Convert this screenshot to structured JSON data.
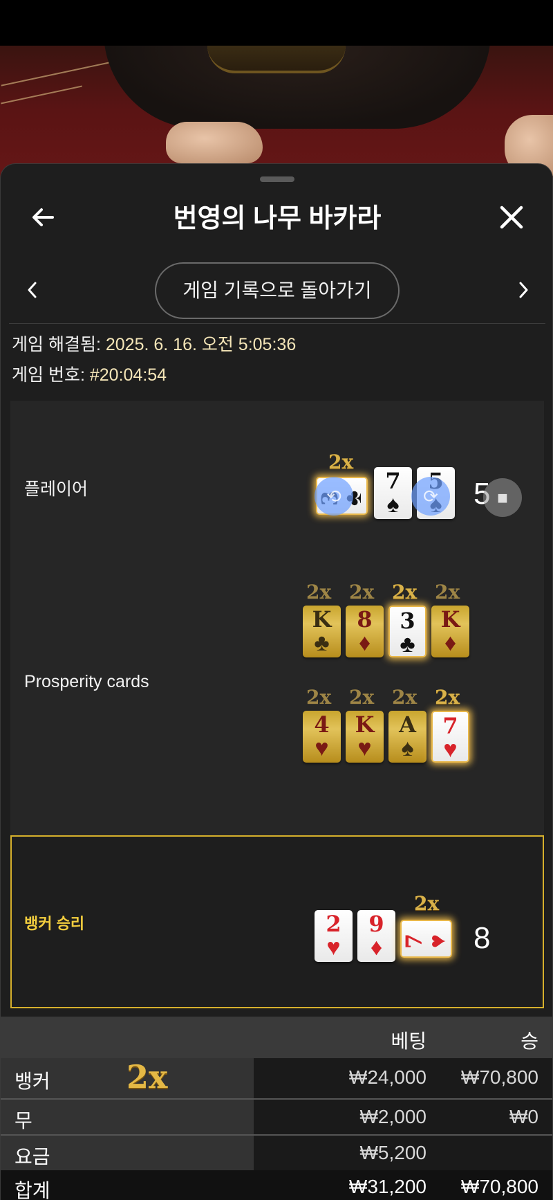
{
  "header": {
    "title": "번영의 나무 바카라"
  },
  "nav": {
    "back_to_history": "게임 기록으로 돌아가기"
  },
  "meta": {
    "resolved_label": "게임 해결됨:",
    "resolved_value": "2025. 6. 16. 오전 5:05:36",
    "round_label": "게임 번호:",
    "round_value": "#20:04:54"
  },
  "player": {
    "label": "플레이어",
    "multiplier": "2x",
    "score": "5",
    "cards": [
      {
        "rank": "3",
        "suit": "♣",
        "color": "black",
        "orientation": "sideways",
        "highlight": true
      },
      {
        "rank": "7",
        "suit": "♠",
        "color": "black"
      },
      {
        "rank": "5",
        "suit": "♠",
        "color": "black"
      }
    ]
  },
  "prosperity": {
    "label": "Prosperity cards",
    "rows": [
      [
        {
          "rank": "K",
          "suit": "♣",
          "color": "black",
          "mult": "2x",
          "active": false
        },
        {
          "rank": "8",
          "suit": "♦",
          "color": "red",
          "mult": "2x",
          "active": false
        },
        {
          "rank": "3",
          "suit": "♣",
          "color": "black",
          "mult": "2x",
          "active": true
        },
        {
          "rank": "K",
          "suit": "♦",
          "color": "red",
          "mult": "2x",
          "active": false
        }
      ],
      [
        {
          "rank": "4",
          "suit": "♥",
          "color": "red",
          "mult": "2x",
          "active": false
        },
        {
          "rank": "K",
          "suit": "♥",
          "color": "red",
          "mult": "2x",
          "active": false
        },
        {
          "rank": "A",
          "suit": "♠",
          "color": "black",
          "mult": "2x",
          "active": false
        },
        {
          "rank": "7",
          "suit": "♥",
          "color": "red",
          "mult": "2x",
          "active": true
        }
      ]
    ]
  },
  "banker": {
    "label": "뱅커 승리",
    "multiplier": "2x",
    "score": "8",
    "cards": [
      {
        "rank": "2",
        "suit": "♥",
        "color": "red"
      },
      {
        "rank": "9",
        "suit": "♦",
        "color": "red"
      },
      {
        "rank": "7",
        "suit": "♥",
        "color": "red",
        "orientation": "sideways",
        "highlight": true
      }
    ]
  },
  "bets": {
    "col_bet": "베팅",
    "col_win": "승",
    "rows": [
      {
        "label": "뱅커",
        "multiplier": "2x",
        "bet": "₩24,000",
        "win": "₩70,800"
      },
      {
        "label": "무",
        "bet": "₩2,000",
        "win": "₩0"
      },
      {
        "label": "요금",
        "bet": "₩5,200",
        "win": ""
      },
      {
        "label": "합계",
        "bet": "₩31,200",
        "win": "₩70,800"
      }
    ]
  },
  "colors": {
    "accent_gold": "#d6b02c",
    "sheet_bg": "#1e1e1e",
    "panel_bg": "#262626"
  }
}
